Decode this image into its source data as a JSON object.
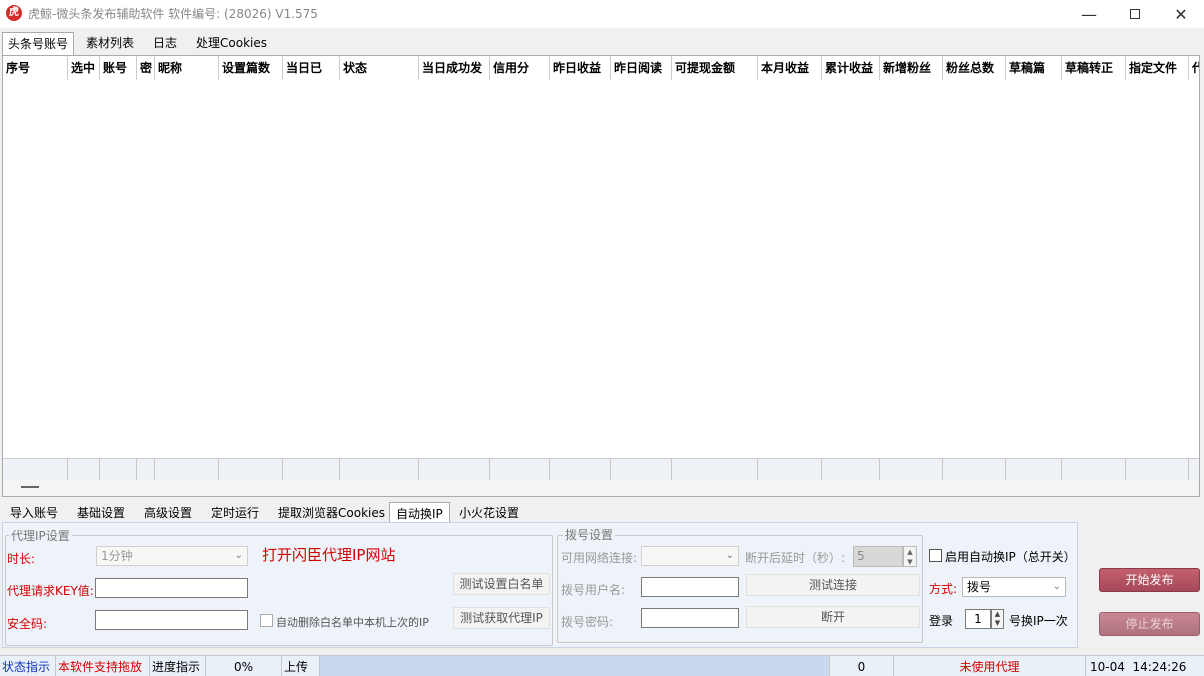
{
  "window": {
    "title": "虎鲸-微头条发布辅助软件 软件编号:  (28026)  V1.575",
    "icon": "app-logo-icon",
    "min_icon": "minimize-icon",
    "max_icon": "maximize-icon",
    "close_icon": "close-icon"
  },
  "top_tabs": [
    "头条号账号",
    "素材列表",
    "日志",
    "处理Cookies"
  ],
  "table": {
    "columns": [
      "序号",
      "选中",
      "账号",
      "密",
      "昵称",
      "设置篇数",
      "当日已",
      "状态",
      "当日成功发",
      "信用分",
      "昨日收益",
      "昨日阅读",
      "可提现金额",
      "本月收益",
      "累计收益",
      "新增粉丝",
      "粉丝总数",
      "草稿篇",
      "草稿转正",
      "指定文件",
      "代"
    ],
    "rows": []
  },
  "bottom_tabs": [
    "导入账号",
    "基础设置",
    "高级设置",
    "定时运行",
    "提取浏览器Cookies",
    "自动换IP",
    "小火花设置"
  ],
  "proxy": {
    "legend": "代理IP设置",
    "duration_label": "时长:",
    "duration_value": "1分钟",
    "open_site_link": "打开闪臣代理IP网站",
    "key_label": "代理请求KEY值:",
    "key_value": "",
    "security_label": "安全码:",
    "security_value": "",
    "auto_delete_label": "自动删除白名单中本机上次的IP",
    "test_whitelist_btn": "测试设置白名单",
    "test_get_proxy_btn": "测试获取代理IP"
  },
  "dialup": {
    "legend": "拨号设置",
    "network_label": "可用网络连接:",
    "network_value": "",
    "delay_label": "断开后延时（秒）:",
    "delay_value": "5",
    "user_label": "拨号用户名:",
    "user_value": "",
    "pass_label": "拨号密码:",
    "pass_value": "",
    "test_connect_btn": "测试连接",
    "disconnect_btn": "断开"
  },
  "autoip": {
    "enable_label": "启用自动换IP（总开关）",
    "mode_label": "方式:",
    "mode_value": "拨号",
    "login_label": "登录",
    "login_count": "1",
    "switch_label": "号换IP一次"
  },
  "actions": {
    "start": "开始发布",
    "stop": "停止发布"
  },
  "status": {
    "indicator": "状态指示",
    "drag_support": "本软件支持拖放",
    "progress_label": "进度指示",
    "progress_value": "0%",
    "upload": "上传",
    "count": "0",
    "proxy_state": "未使用代理",
    "date": "10-04",
    "time": "14:24:26"
  },
  "colors": {
    "accent_red": "#d40000",
    "status_blue": "#1030c0",
    "button_start": "#b04a5a"
  }
}
